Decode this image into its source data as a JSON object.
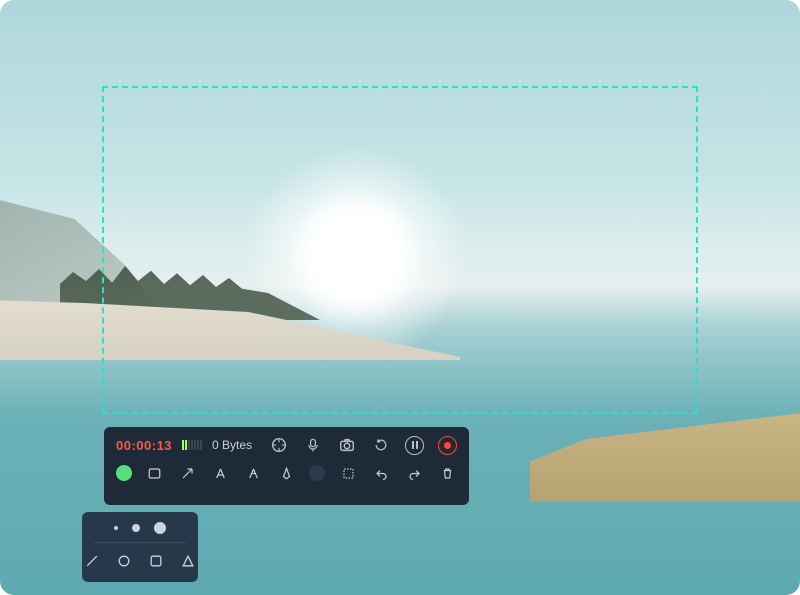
{
  "status": {
    "timer": "00:00:13",
    "file_size": "0 Bytes",
    "audio_levels": [
      true,
      true,
      false,
      false,
      false,
      false,
      false
    ]
  },
  "controls": {
    "cursor": "cursor-highlight-icon",
    "mic": "microphone-icon",
    "camera": "camera-icon",
    "restart": "restart-icon",
    "pause": "pause-icon",
    "record": "record-icon"
  },
  "tools": {
    "color": "#54e07a",
    "rect": "rectangle-tool",
    "arrow": "arrow-tool",
    "text": "text-tool",
    "highlighter": "highlighter-tool",
    "pen": "pen-tool",
    "ellipse": "ellipse-tool",
    "marquee": "marquee-tool",
    "undo": "undo-icon",
    "redo": "redo-icon",
    "trash": "trash-icon"
  },
  "popup": {
    "sizes": [
      "small",
      "medium",
      "large"
    ],
    "shapes": [
      "line",
      "circle",
      "square",
      "triangle"
    ]
  }
}
